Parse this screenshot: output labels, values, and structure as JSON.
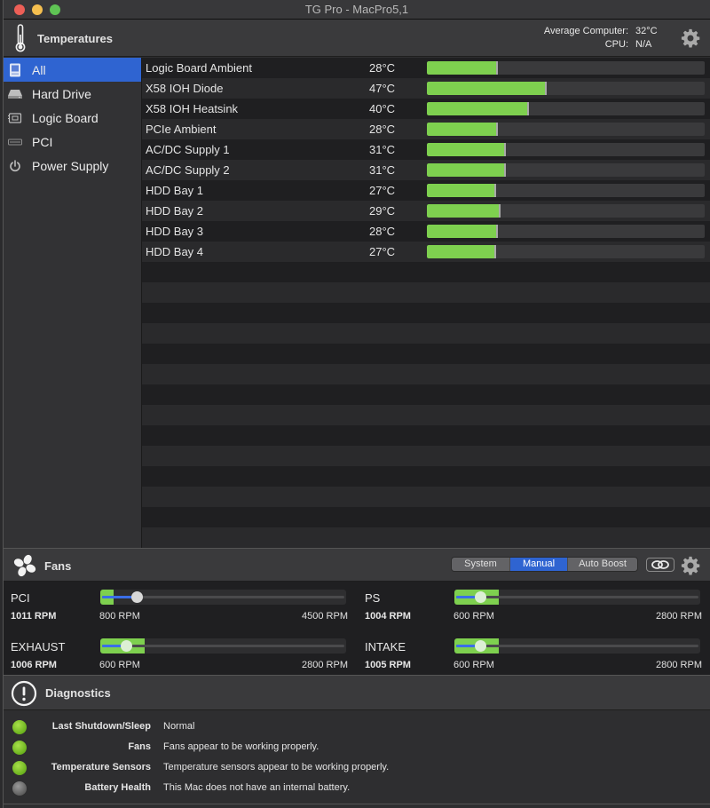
{
  "window": {
    "title": "TG Pro - MacPro5,1"
  },
  "temperatures": {
    "header": "Temperatures",
    "average_label": "Average Computer:",
    "average_value": "32°C",
    "cpu_label": "CPU:",
    "cpu_value": "N/A",
    "bar_scale_max_c": 109,
    "categories": [
      {
        "label": "All",
        "icon": "computer-icon",
        "selected": true
      },
      {
        "label": "Hard Drive",
        "icon": "hard-drive-icon",
        "selected": false
      },
      {
        "label": "Logic Board",
        "icon": "logic-board-icon",
        "selected": false
      },
      {
        "label": "PCI",
        "icon": "pci-icon",
        "selected": false
      },
      {
        "label": "Power Supply",
        "icon": "power-icon",
        "selected": false
      }
    ],
    "sensors": [
      {
        "name": "Logic Board Ambient",
        "temp": "28°C",
        "value_c": 28
      },
      {
        "name": "X58 IOH Diode",
        "temp": "47°C",
        "value_c": 47
      },
      {
        "name": "X58 IOH Heatsink",
        "temp": "40°C",
        "value_c": 40
      },
      {
        "name": "PCIe Ambient",
        "temp": "28°C",
        "value_c": 28
      },
      {
        "name": "AC/DC Supply 1",
        "temp": "31°C",
        "value_c": 31
      },
      {
        "name": "AC/DC Supply 2",
        "temp": "31°C",
        "value_c": 31
      },
      {
        "name": "HDD Bay 1",
        "temp": "27°C",
        "value_c": 27
      },
      {
        "name": "HDD Bay 2",
        "temp": "29°C",
        "value_c": 29
      },
      {
        "name": "HDD Bay 3",
        "temp": "28°C",
        "value_c": 28
      },
      {
        "name": "HDD Bay 4",
        "temp": "27°C",
        "value_c": 27
      }
    ],
    "empty_rows": 14,
    "bar_color": "#7ed04f"
  },
  "fans": {
    "header": "Fans",
    "modes": [
      {
        "label": "System",
        "selected": false
      },
      {
        "label": "Manual",
        "selected": true
      },
      {
        "label": "Auto Boost",
        "selected": false
      }
    ],
    "accent": "#2f64d1",
    "items": [
      {
        "name": "PCI",
        "rpm": "1011 RPM",
        "current_rpm": 1011,
        "min_label": "800 RPM",
        "max_label": "4500 RPM",
        "min_rpm": 800,
        "max_rpm": 4500,
        "set_rpm": 1300
      },
      {
        "name": "PS",
        "rpm": "1004 RPM",
        "current_rpm": 1004,
        "min_label": "600 RPM",
        "max_label": "2800 RPM",
        "min_rpm": 600,
        "max_rpm": 2800,
        "set_rpm": 850
      },
      {
        "name": "EXHAUST",
        "rpm": "1006 RPM",
        "current_rpm": 1006,
        "min_label": "600 RPM",
        "max_label": "2800 RPM",
        "min_rpm": 600,
        "max_rpm": 2800,
        "set_rpm": 850
      },
      {
        "name": "INTAKE",
        "rpm": "1005 RPM",
        "current_rpm": 1005,
        "min_label": "600 RPM",
        "max_label": "2800 RPM",
        "min_rpm": 600,
        "max_rpm": 2800,
        "set_rpm": 850
      }
    ]
  },
  "diagnostics": {
    "header": "Diagnostics",
    "rows": [
      {
        "label": "Last Shutdown/Sleep",
        "message": "Normal",
        "status": "ok"
      },
      {
        "label": "Fans",
        "message": "Fans appear to be working properly.",
        "status": "ok"
      },
      {
        "label": "Temperature Sensors",
        "message": "Temperature sensors appear to be working properly.",
        "status": "ok"
      },
      {
        "label": "Battery Health",
        "message": "This Mac does not have an internal battery.",
        "status": "na"
      }
    ],
    "status_colors": {
      "ok": "#7cc532",
      "na": "#7a7a7a"
    }
  }
}
